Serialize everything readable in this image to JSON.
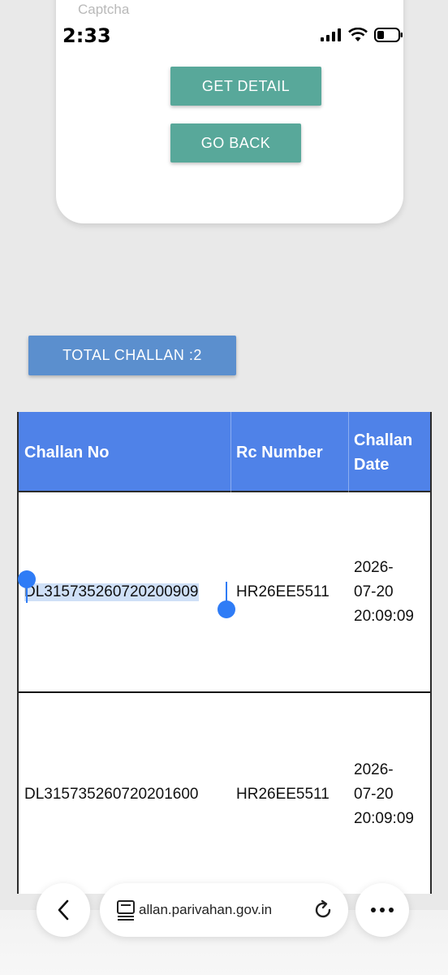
{
  "status": {
    "time": "2:33"
  },
  "form": {
    "captcha_label": "Captcha",
    "get_detail_label": "GET DETAIL",
    "go_back_label": "GO BACK"
  },
  "summary": {
    "total_label": "TOTAL CHALLAN :2"
  },
  "table": {
    "headers": [
      "Challan No",
      "Rc Number",
      "Challan Date"
    ],
    "rows": [
      {
        "challan_no": "DL315735260720200909",
        "rc_number": "HR26EE5511",
        "date_l1": "2026-",
        "date_l2": "07-20",
        "date_l3": "20:09:09"
      },
      {
        "challan_no": "DL315735260720201600",
        "rc_number": "HR26EE5511",
        "date_l1": "2026-",
        "date_l2": "07-20",
        "date_l3": "20:09:09"
      }
    ]
  },
  "browser": {
    "url": "allan.parivahan.gov.in"
  },
  "colors": {
    "teal_button": "#58a89a",
    "total_button": "#5b8fce",
    "table_header": "#4f82e8",
    "selection": "#2f7cf6"
  }
}
